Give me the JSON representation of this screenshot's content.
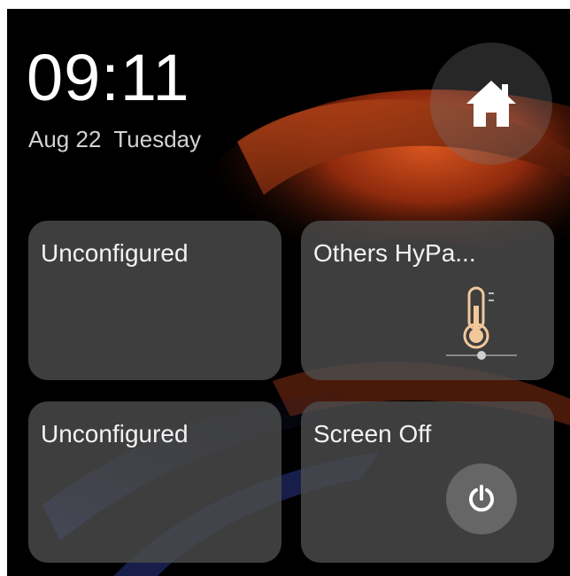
{
  "status": {
    "time": "09:11",
    "date": "Aug 22  Tuesday"
  },
  "home_button": {
    "icon": "home-icon"
  },
  "tiles": [
    {
      "label": "Unconfigured",
      "icon": ""
    },
    {
      "label": "Others HyPa...",
      "icon": "thermometer-icon"
    },
    {
      "label": "Unconfigured",
      "icon": ""
    },
    {
      "label": "Screen Off",
      "icon": "power-icon"
    }
  ],
  "colors": {
    "background": "#000000",
    "tile": "#4e4e4e",
    "accent_orange": "#c9471d",
    "thermometer": "#f2c89a",
    "text": "#f2f2f2"
  }
}
